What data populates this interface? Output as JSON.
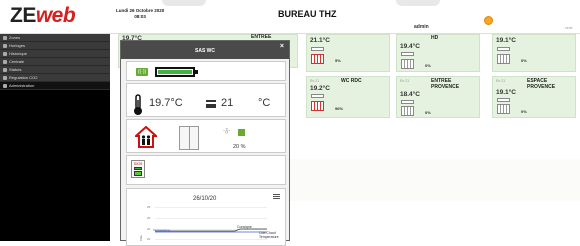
{
  "header": {
    "logo_ze": "ZE",
    "logo_web": "web",
    "date_line1": "Lundi 26 Octobre 2020",
    "date_line2": "08:03",
    "title": "BUREAU THZ",
    "user": "admin",
    "version": "versi"
  },
  "sidebar": {
    "items": [
      {
        "label": "Zones",
        "icon": "zones-icon"
      },
      {
        "label": "Horloges",
        "icon": "clock-icon"
      },
      {
        "label": "Historique",
        "icon": "chart-icon"
      },
      {
        "label": "Centrale",
        "icon": "central-icon"
      },
      {
        "label": "Statuts",
        "icon": "status-icon"
      },
      {
        "label": "Régulation CO2",
        "icon": "co2-icon"
      },
      {
        "label": "Administration",
        "icon": "wrench-icon"
      }
    ]
  },
  "rooms": [
    {
      "temp": "19.7°C",
      "name": "ENTREE",
      "small": "",
      "pct": "5%"
    },
    {
      "temp": "21.1°C",
      "name": "",
      "small": "",
      "pct": "5%"
    },
    {
      "temp": "19.4°C",
      "name": "HD",
      "small": "",
      "pct": "0%"
    },
    {
      "temp": "19.1°C",
      "name": "",
      "small": "",
      "pct": "0%"
    },
    {
      "temp": "19.2°C",
      "name": "WC RDC",
      "small": "Rx 21",
      "pct": "96%"
    },
    {
      "temp": "18.4°C",
      "name": "ENTREE PROVENCE",
      "small": "Rx 21",
      "pct": "0%"
    },
    {
      "temp": "19.1°C",
      "name": "ESPACE PROVENCE",
      "small": "Rx 21",
      "pct": "0%"
    }
  ],
  "modal": {
    "title": "SAS WC",
    "close": "×",
    "temperature": "19.7°C",
    "setpoint": "21",
    "unit": "°C",
    "humidity": "20 %",
    "device": "SX25",
    "chart": {
      "date": "26/10/20",
      "consigne_label": "Consigne",
      "temperature_label": "Temperature",
      "cde_line1": "Cde.Chauf",
      "cde_line2": "Temperature",
      "ylabel": "Cde"
    }
  },
  "chart_data": {
    "type": "line",
    "title": "26/10/20",
    "ylabel": "Cde",
    "y_ticks": [
      "25",
      "20",
      "20",
      "20"
    ],
    "series": [
      {
        "name": "Consigne"
      },
      {
        "name": "Temperature"
      }
    ],
    "legend": [
      "Cde.Chauf",
      "Temperature"
    ]
  }
}
